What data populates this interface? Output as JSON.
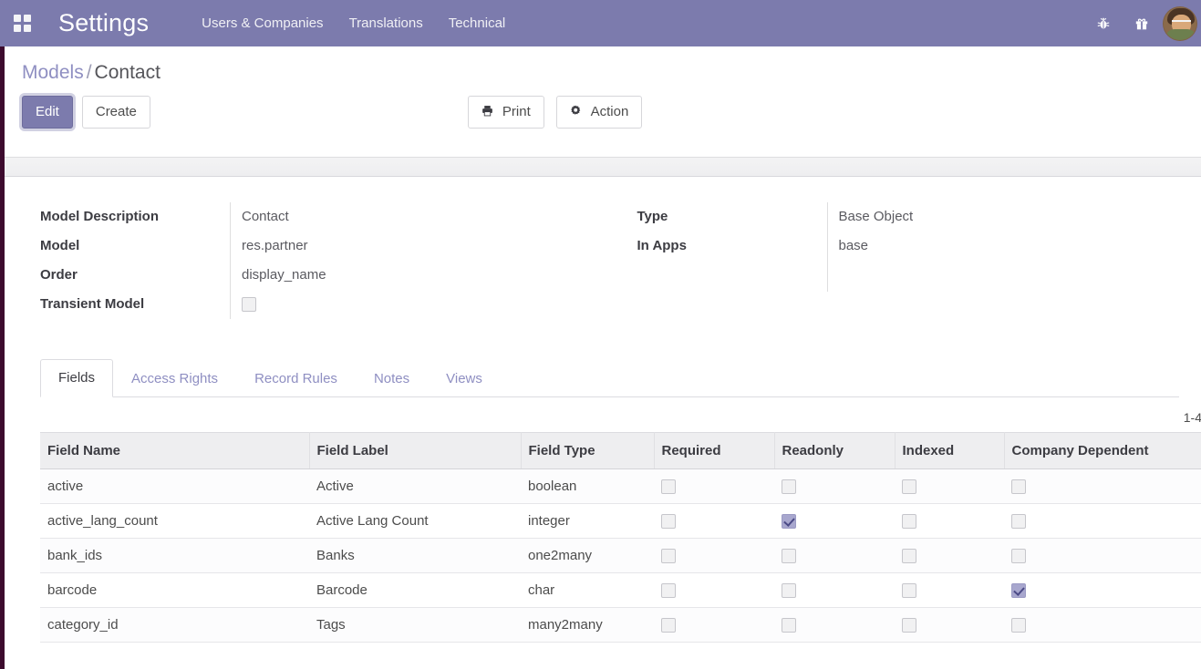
{
  "navbar": {
    "apps_icon": "apps-grid-icon",
    "brand": "Settings",
    "menus": [
      {
        "label": "Users & Companies"
      },
      {
        "label": "Translations"
      },
      {
        "label": "Technical"
      }
    ],
    "icons": [
      {
        "name": "bug-icon",
        "glyph": "☲"
      },
      {
        "name": "gift-icon",
        "glyph": "☗"
      }
    ],
    "avatar_alt": "user-avatar",
    "bg_color": "#7c7bad"
  },
  "control_panel": {
    "breadcrumb": {
      "parent": "Models",
      "separator": "/",
      "current": "Contact"
    },
    "buttons": {
      "edit": "Edit",
      "create": "Create",
      "print": "Print",
      "action": "Action"
    },
    "icons": {
      "print": "printer-icon",
      "action": "gear-icon"
    }
  },
  "form": {
    "left": [
      {
        "label": "Model Description",
        "value": "Contact",
        "type": "text"
      },
      {
        "label": "Model",
        "value": "res.partner",
        "type": "text"
      },
      {
        "label": "Order",
        "value": "display_name",
        "type": "text"
      },
      {
        "label": "Transient Model",
        "value": "",
        "type": "checkbox",
        "checked": false
      }
    ],
    "right": [
      {
        "label": "Type",
        "value": "Base Object",
        "type": "text"
      },
      {
        "label": "In Apps",
        "value": "base",
        "type": "text"
      }
    ]
  },
  "notebook": {
    "tabs": [
      {
        "label": "Fields",
        "active": true
      },
      {
        "label": "Access Rights",
        "active": false
      },
      {
        "label": "Record Rules",
        "active": false
      },
      {
        "label": "Notes",
        "active": false
      },
      {
        "label": "Views",
        "active": false
      }
    ]
  },
  "pager": {
    "text": "1-4"
  },
  "table": {
    "columns": [
      {
        "label": "Field Name",
        "key": "name"
      },
      {
        "label": "Field Label",
        "key": "label"
      },
      {
        "label": "Field Type",
        "key": "type"
      },
      {
        "label": "Required",
        "key": "required"
      },
      {
        "label": "Readonly",
        "key": "readonly"
      },
      {
        "label": "Indexed",
        "key": "indexed"
      },
      {
        "label": "Company Dependent",
        "key": "company_dependent"
      }
    ],
    "rows": [
      {
        "name": "active",
        "label": "Active",
        "type": "boolean",
        "required": false,
        "readonly": false,
        "indexed": false,
        "company_dependent": false
      },
      {
        "name": "active_lang_count",
        "label": "Active Lang Count",
        "type": "integer",
        "required": false,
        "readonly": true,
        "indexed": false,
        "company_dependent": false
      },
      {
        "name": "bank_ids",
        "label": "Banks",
        "type": "one2many",
        "required": false,
        "readonly": false,
        "indexed": false,
        "company_dependent": false
      },
      {
        "name": "barcode",
        "label": "Barcode",
        "type": "char",
        "required": false,
        "readonly": false,
        "indexed": false,
        "company_dependent": true
      },
      {
        "name": "category_id",
        "label": "Tags",
        "type": "many2many",
        "required": false,
        "readonly": false,
        "indexed": false,
        "company_dependent": false
      }
    ]
  },
  "colors": {
    "brand_purple": "#7c7bad",
    "link_purple": "#8f8fc2",
    "edge_stripe": "#3d0b2e",
    "checkbox_checked": "#a8a7ce"
  }
}
